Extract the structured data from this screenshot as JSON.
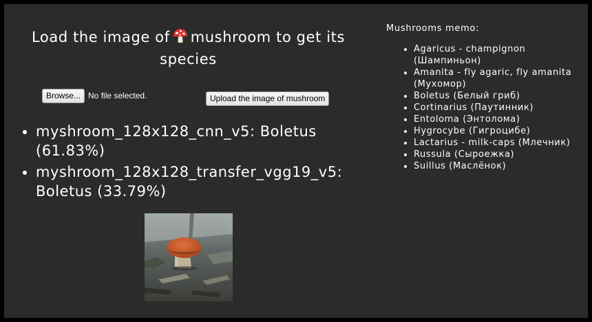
{
  "header": {
    "title_before": "Load the image of",
    "title_emoji": "mushroom-icon",
    "title_after": "mushroom to get its species"
  },
  "upload": {
    "browse_label": "Browse...",
    "file_status": "No file selected.",
    "upload_label": "Upload the image of mushroom"
  },
  "results": [
    {
      "text": "myshroom_128x128_cnn_v5: Boletus (61.83%)"
    },
    {
      "text": "myshroom_128x128_transfer_vgg19_v5: Boletus (33.79%)"
    }
  ],
  "photo": {
    "subject": "uploaded-mushroom-photo"
  },
  "memo": {
    "title": "Mushrooms memo:",
    "items": [
      {
        "text": "Agaricus - champignon (Шампиньон)"
      },
      {
        "text": "Amanita - fly agaric, fly amanita (Мухомор)"
      },
      {
        "text": "Boletus (Белый гриб)"
      },
      {
        "text": "Cortinarius (Паутинник)"
      },
      {
        "text": "Entoloma (Энтолома)"
      },
      {
        "text": "Hygrocybe (Гигроцибе)"
      },
      {
        "text": "Lactarius - milk-caps (Млечник)"
      },
      {
        "text": "Russula (Сыроежка)"
      },
      {
        "text": "Suillus (Маслёнок)"
      }
    ]
  },
  "colors": {
    "page_background": "#000000",
    "panel_background": "#2b2b2b",
    "text": "#ffffff"
  }
}
